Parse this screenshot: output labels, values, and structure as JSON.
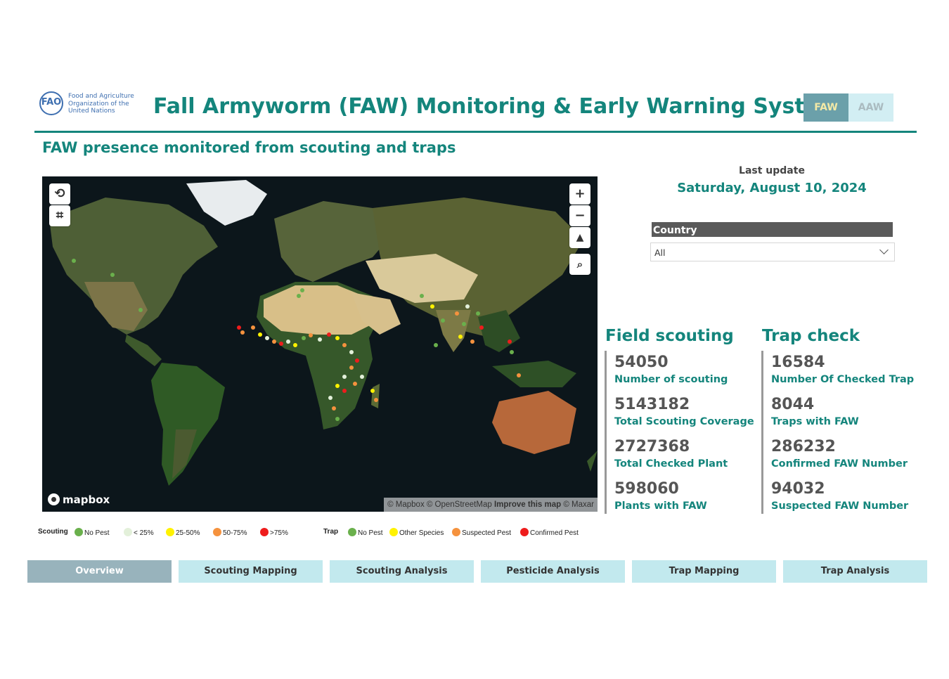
{
  "header": {
    "org_logo_lines": [
      "Food and Agriculture",
      "Organization of the",
      "United Nations"
    ],
    "org_logo_mark": "FAO",
    "title": "Fall Armyworm (FAW) Monitoring & Early Warning System",
    "toggle": {
      "faw_label": "FAW",
      "aaw_label": "AAW",
      "selected": "FAW"
    }
  },
  "subtitle": "FAW presence monitored from scouting and traps",
  "map": {
    "mapbox_label": "mapbox",
    "attribution_prefix": "© Mapbox © OpenStreetMap",
    "attribution_link": "Improve this map",
    "attribution_suffix": "© Maxar",
    "controls": [
      "zoom-in",
      "zoom-out",
      "reset-north",
      "search"
    ],
    "tools": [
      "lasso-select",
      "rectangle-select"
    ]
  },
  "legend": {
    "scouting": {
      "title": "Scouting",
      "items": [
        {
          "label": "No Pest",
          "color": "#6ab04c"
        },
        {
          "label": "< 25%",
          "color": "#e3f0da"
        },
        {
          "label": "25-50%",
          "color": "#fff200"
        },
        {
          "label": "50-75%",
          "color": "#f5923e"
        },
        {
          "label": ">75%",
          "color": "#ee1c1c"
        }
      ]
    },
    "trap": {
      "title": "Trap",
      "items": [
        {
          "label": "No Pest",
          "color": "#6ab04c"
        },
        {
          "label": "Other Species",
          "color": "#fff200"
        },
        {
          "label": "Suspected Pest",
          "color": "#f5923e"
        },
        {
          "label": "Confirmed Pest",
          "color": "#ee1c1c"
        }
      ]
    }
  },
  "last_update": {
    "label": "Last update",
    "value": "Saturday, August 10, 2024"
  },
  "filter": {
    "label": "Country",
    "value": "All"
  },
  "field_scouting": {
    "title": "Field scouting",
    "kpis": [
      {
        "value": "54050",
        "label": "Number of scouting"
      },
      {
        "value": "5143182",
        "label": "Total Scouting Coverage"
      },
      {
        "value": "2727368",
        "label": "Total Checked Plant"
      },
      {
        "value": "598060",
        "label": "Plants with FAW"
      }
    ]
  },
  "trap_check": {
    "title": "Trap check",
    "kpis": [
      {
        "value": "16584",
        "label": "Number Of Checked Trap"
      },
      {
        "value": "8044",
        "label": "Traps with FAW"
      },
      {
        "value": "286232",
        "label": "Confirmed FAW Number"
      },
      {
        "value": "94032",
        "label": "Suspected FAW Number"
      }
    ]
  },
  "nav": {
    "tabs": [
      {
        "label": "Overview",
        "active": true
      },
      {
        "label": "Scouting Mapping",
        "active": false
      },
      {
        "label": "Scouting Analysis",
        "active": false
      },
      {
        "label": "Pesticide Analysis",
        "active": false
      },
      {
        "label": "Trap Mapping",
        "active": false
      },
      {
        "label": "Trap Analysis",
        "active": false
      }
    ]
  }
}
